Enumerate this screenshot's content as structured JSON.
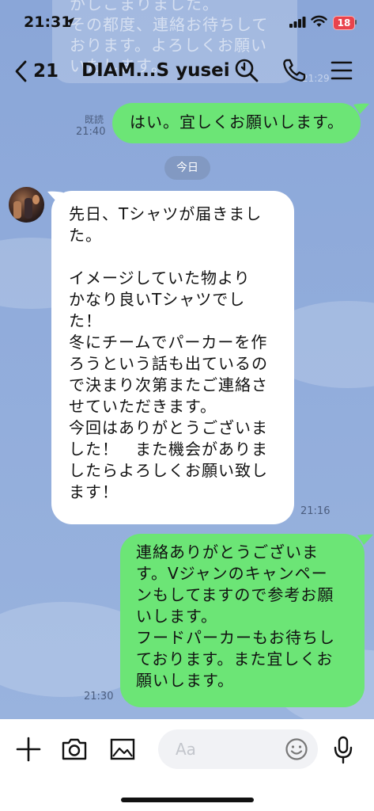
{
  "status_bar": {
    "time": "21:31",
    "battery": "18"
  },
  "header": {
    "back_count": "21",
    "title": "DIAM...S yusei"
  },
  "background": {
    "ghost_text": "かしこまりました。\nその都度、連絡お待ちして\nおります。よろしくお願い\nいたします。",
    "ghost_time": "21:29"
  },
  "messages": [
    {
      "side": "right",
      "text": "はい。宜しくお願いします。",
      "read": "既読",
      "time": "21:40"
    },
    {
      "type": "date",
      "label": "今日"
    },
    {
      "side": "left",
      "text": "先日、Tシャツが届きまし\nた。\n\nイメージしていた物より\nかなり良いTシャツでし\nた！\n冬にチームでパーカーを作\nろうという話も出ているの\nで決まり次第またご連絡さ\nせていただきます。\n今回はありがとうございま\nした！　また機会がありま\nしたらよろしくお願い致し\nます！",
      "time": "21:16"
    },
    {
      "side": "right",
      "text": "連絡ありがとうございま\nす。Vジャンのキャンペー\nンもしてますので参考お願\nいします。\nフードパーカーもお待ちし\nております。また宜しくお\n願いします。",
      "time": "21:30"
    }
  ],
  "input": {
    "placeholder": "Aa"
  },
  "colors": {
    "chat_bg": "#8ca7d9",
    "my_bubble": "#6ce576",
    "their_bubble": "#ffffff",
    "battery": "#e9434c"
  },
  "icons": [
    "location-arrow-icon",
    "signal-icon",
    "wifi-icon",
    "back-chevron-icon",
    "search-icon",
    "phone-icon",
    "menu-icon",
    "plus-icon",
    "camera-icon",
    "image-icon",
    "emoji-icon",
    "microphone-icon"
  ]
}
